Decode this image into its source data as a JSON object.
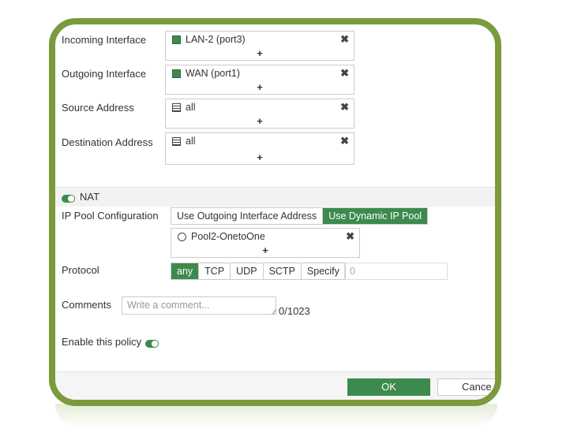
{
  "fields": [
    {
      "label": "Incoming Interface",
      "value": "LAN-2 (port3)",
      "icon": "port-icon"
    },
    {
      "label": "Outgoing Interface",
      "value": "WAN (port1)",
      "icon": "port-icon"
    },
    {
      "label": "Source Address",
      "value": "all",
      "icon": "address-icon"
    },
    {
      "label": "Destination Address",
      "value": "all",
      "icon": "address-icon"
    }
  ],
  "nat": {
    "label": "NAT",
    "enabled": true
  },
  "ip_pool": {
    "label": "IP Pool Configuration",
    "options": [
      "Use Outgoing Interface Address",
      "Use Dynamic IP Pool"
    ],
    "selected": "Use Dynamic IP Pool",
    "pool_value": "Pool2-OnetoOne"
  },
  "protocol": {
    "label": "Protocol",
    "options": [
      "any",
      "TCP",
      "UDP",
      "SCTP",
      "Specify"
    ],
    "selected": "any",
    "number_value": "0"
  },
  "comments": {
    "label": "Comments",
    "placeholder": "Write a comment...",
    "counter": "0/1023"
  },
  "enable_policy": {
    "label": "Enable this policy",
    "enabled": true
  },
  "footer": {
    "ok_label": "OK",
    "cancel_label": "Cance"
  },
  "glyphs": {
    "remove": "✖",
    "add": "+"
  },
  "colors": {
    "accent": "#3c8a4d",
    "frame": "#7a9a3c"
  }
}
